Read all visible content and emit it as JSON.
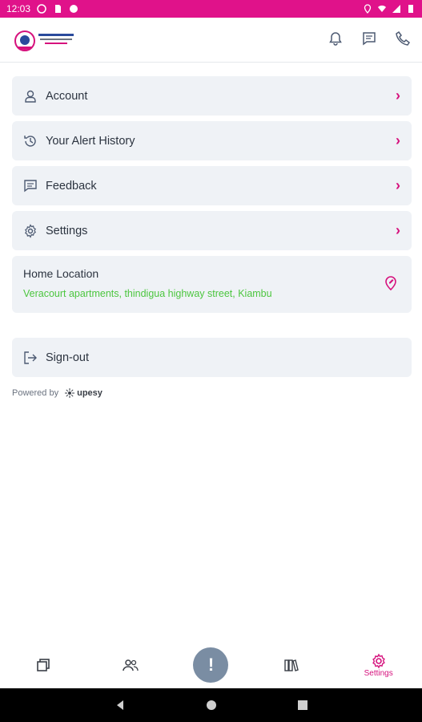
{
  "status_bar": {
    "time": "12:03"
  },
  "menu": [
    {
      "label": "Account",
      "icon": "user-icon"
    },
    {
      "label": "Your Alert History",
      "icon": "history-icon"
    },
    {
      "label": "Feedback",
      "icon": "feedback-icon"
    },
    {
      "label": "Settings",
      "icon": "gear-icon"
    }
  ],
  "home_location": {
    "title": "Home Location",
    "address": "Veracourt apartments, thindigua highway street, Kiambu"
  },
  "signout": {
    "label": "Sign-out"
  },
  "powered": {
    "label": "Powered by",
    "brand": "upesy"
  },
  "bottom_nav": {
    "settings_label": "Settings"
  },
  "colors": {
    "accent": "#d6127d",
    "status_bar": "#e0128a",
    "address": "#4cc63f",
    "card_bg": "#eff2f6"
  }
}
